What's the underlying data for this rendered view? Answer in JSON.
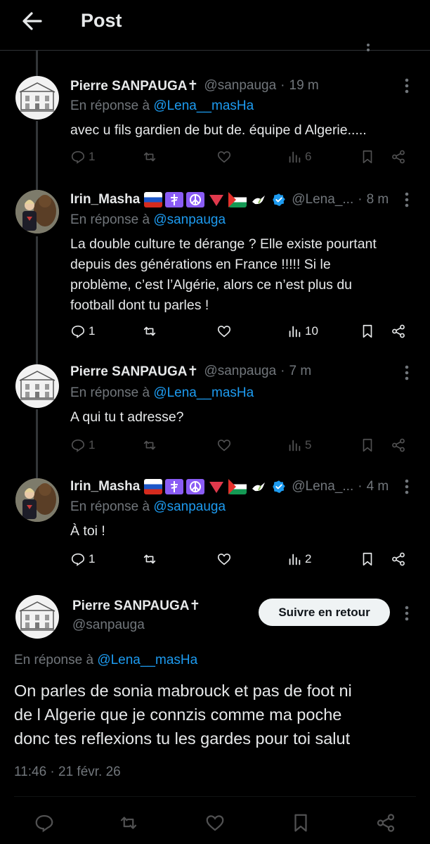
{
  "header": {
    "title": "Post"
  },
  "replies": [
    {
      "name": "Pierre SANPAUGA✝",
      "handle": "@sanpauga",
      "time": "19 m",
      "reply_to_prefix": "En réponse à",
      "reply_to": "@Lena__masHa",
      "lines": [
        "avec u fils gardien de but de. équipe d Algerie....."
      ],
      "replies": "1",
      "views": "6"
    },
    {
      "name": "Irin_Masha",
      "handle": "@Lena_...",
      "time": "8 m",
      "reply_to_prefix": "En réponse à",
      "reply_to": "@sanpauga",
      "lines": [
        "La double culture te dérange ? Elle existe pourtant",
        "depuis des générations en France !!!!! Si le",
        "problème, c’est l’Algérie, alors ce n’est plus du",
        "football dont tu parles !"
      ],
      "replies": "1",
      "views": "10"
    },
    {
      "name": "Pierre SANPAUGA✝",
      "handle": "@sanpauga",
      "time": "7 m",
      "reply_to_prefix": "En réponse à",
      "reply_to": "@Lena__masHa",
      "lines": [
        "A qui tu t adresse?"
      ],
      "replies": "1",
      "views": "5"
    },
    {
      "name": "Irin_Masha",
      "handle": "@Lena_...",
      "time": "4 m",
      "reply_to_prefix": "En réponse à",
      "reply_to": "@sanpauga",
      "lines": [
        "À toi !"
      ],
      "replies": "1",
      "views": "2"
    }
  ],
  "main_post": {
    "name": "Pierre SANPAUGA✝",
    "handle": "@sanpauga",
    "follow_label": "Suivre en retour",
    "reply_to_prefix": "En réponse à",
    "reply_to": "@Lena__masHa",
    "lines": [
      "On parles de sonia mabrouck et pas de foot ni",
      "de l Algerie que je connzis comme ma poche",
      "donc tes reflexions tu les gardes pour toi salut"
    ],
    "date": "11:46 · 21 févr. 26"
  },
  "colors": {
    "accent": "#1d9bf0",
    "muted": "#71767b",
    "text": "#e7e9ea",
    "background": "#000000",
    "divider": "#2f3336"
  },
  "icons": [
    "back-arrow-icon",
    "reply-icon",
    "retweet-icon",
    "like-icon",
    "views-icon",
    "bookmark-icon",
    "share-icon",
    "more-icon",
    "verified-icon"
  ]
}
